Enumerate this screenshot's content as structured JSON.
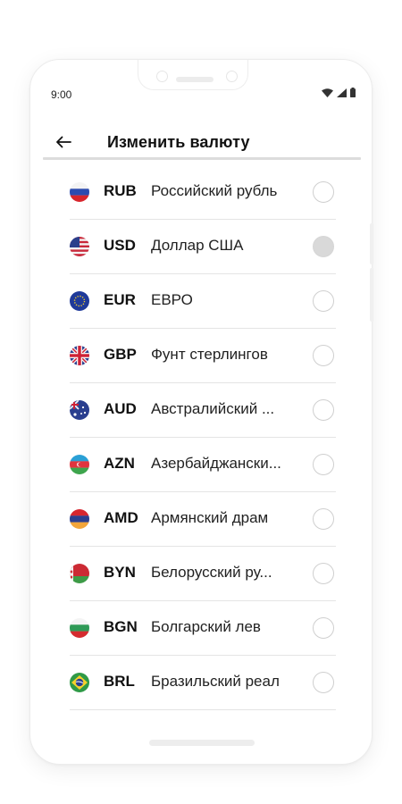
{
  "status_bar": {
    "time": "9:00",
    "icons": [
      "wifi-icon",
      "signal-icon",
      "battery-icon"
    ]
  },
  "header": {
    "back_icon": "arrow-left-icon",
    "title": "Изменить валюту"
  },
  "currencies": [
    {
      "code": "RUB",
      "name": "Российский рубль",
      "flag": "russia-flag-icon",
      "selected": false
    },
    {
      "code": "USD",
      "name": "Доллар США",
      "flag": "usa-flag-icon",
      "selected": true
    },
    {
      "code": "EUR",
      "name": "ЕВРО",
      "flag": "eu-flag-icon",
      "selected": false
    },
    {
      "code": "GBP",
      "name": "Фунт стерлингов",
      "flag": "uk-flag-icon",
      "selected": false
    },
    {
      "code": "AUD",
      "name": "Австралийский ...",
      "flag": "australia-flag-icon",
      "selected": false
    },
    {
      "code": "AZN",
      "name": "Азербайджански...",
      "flag": "azerbaijan-flag-icon",
      "selected": false
    },
    {
      "code": "AMD",
      "name": "Армянский драм",
      "flag": "armenia-flag-icon",
      "selected": false
    },
    {
      "code": "BYN",
      "name": "Белорусский ру...",
      "flag": "belarus-flag-icon",
      "selected": false
    },
    {
      "code": "BGN",
      "name": "Болгарский лев",
      "flag": "bulgaria-flag-icon",
      "selected": false
    },
    {
      "code": "BRL",
      "name": "Бразильский реал",
      "flag": "brazil-flag-icon",
      "selected": false
    }
  ],
  "colors": {
    "selected_radio": "#d9d9d9",
    "divider": "#e4e4e4",
    "text": "#111111"
  }
}
